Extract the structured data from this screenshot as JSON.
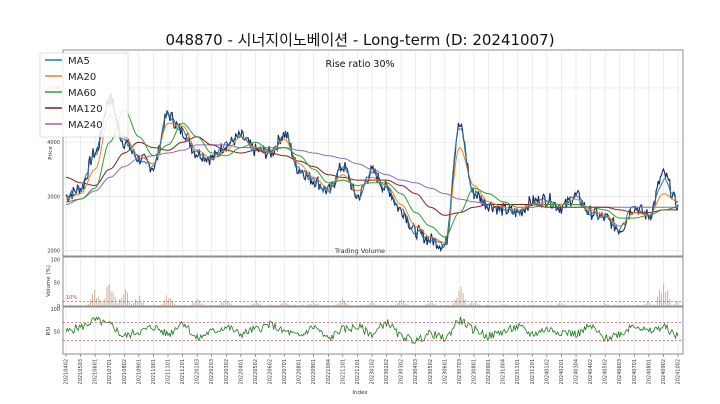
{
  "chart_data": {
    "type": "line",
    "title": "048870 - 시너지이노베이션 - Long-term (D: 20241007)",
    "annotation": "Rise ratio 30%",
    "volume_label": "Trading Volume",
    "xlabel": "Index",
    "ylabel": "Price",
    "volume_ylabel": "Volume (%)",
    "rsi_ylabel": "RSI",
    "volume_threshold_label": "10%",
    "ylim": [
      1900,
      5700
    ],
    "yticks": [
      2000,
      3000,
      4000,
      5000
    ],
    "volume_yticks": [
      0,
      50,
      100
    ],
    "volume_ylim": [
      0,
      105
    ],
    "volume_threshold": 10,
    "rsi_yticks": [
      50,
      100
    ],
    "rsi_ylim": [
      0,
      105
    ],
    "rsi_lines": [
      70,
      30
    ],
    "grid": true,
    "legend_position": "top-left",
    "colors": {
      "price": "#1a2a5a",
      "MA5": "#1f77b4",
      "MA20": "#ff7f0e",
      "MA60": "#2ca02c",
      "MA120": "#8c1c1c",
      "MA240": "#9467bd",
      "volume": "#c8a894",
      "rsi": "#1a7a1a",
      "threshold": "#cc3333"
    },
    "x_dates": [
      "20210402",
      "20210503",
      "20210601",
      "20210701",
      "20210802",
      "20210901",
      "20211001",
      "20211101",
      "20211201",
      "20220103",
      "20220203",
      "20220302",
      "20220401",
      "20220502",
      "20220602",
      "20220701",
      "20220801",
      "20220901",
      "20221004",
      "20221101",
      "20221201",
      "20230102",
      "20230202",
      "20230302",
      "20230403",
      "20230502",
      "20230601",
      "20230703",
      "20230801",
      "20230901",
      "20231004",
      "20231101",
      "20231201",
      "20240102",
      "20240201",
      "20240304",
      "20240402",
      "20240502",
      "20240603",
      "20240701",
      "20240801",
      "20240902",
      "20241002"
    ],
    "price_anchors": [
      3000,
      3150,
      3800,
      4800,
      4000,
      3700,
      3550,
      4500,
      4200,
      3800,
      3700,
      3950,
      4100,
      3850,
      3800,
      4150,
      3500,
      3300,
      3100,
      3550,
      3000,
      3450,
      3150,
      2750,
      2350,
      2200,
      2100,
      4300,
      3050,
      2850,
      2750,
      2700,
      2900,
      2950,
      2800,
      3000,
      2700,
      2600,
      2400,
      2800,
      2650,
      3400,
      2850
    ],
    "ma_anchors": {
      "MA5": [
        3000,
        3150,
        3800,
        4800,
        4000,
        3700,
        3550,
        4500,
        4200,
        3800,
        3700,
        3950,
        4100,
        3850,
        3800,
        4150,
        3500,
        3300,
        3100,
        3550,
        3000,
        3450,
        3150,
        2750,
        2350,
        2200,
        2100,
        4300,
        3050,
        2850,
        2750,
        2700,
        2900,
        2950,
        2800,
        3000,
        2700,
        2600,
        2400,
        2800,
        2650,
        3300,
        2900
      ],
      "MA20": [
        2950,
        3050,
        3500,
        4500,
        4100,
        3750,
        3600,
        4350,
        4300,
        3850,
        3700,
        3850,
        4100,
        3900,
        3800,
        4050,
        3600,
        3350,
        3150,
        3400,
        3100,
        3350,
        3200,
        2850,
        2450,
        2250,
        2150,
        3900,
        3200,
        2900,
        2800,
        2750,
        2850,
        2900,
        2850,
        2950,
        2750,
        2650,
        2450,
        2700,
        2650,
        3050,
        2900
      ],
      "MA60": [
        2900,
        2950,
        3150,
        4000,
        4600,
        4100,
        3750,
        3950,
        4350,
        4100,
        3800,
        3750,
        3900,
        4000,
        3850,
        3900,
        3750,
        3500,
        3250,
        3300,
        3200,
        3250,
        3250,
        3050,
        2700,
        2450,
        2250,
        2700,
        3150,
        3050,
        2900,
        2800,
        2800,
        2850,
        2850,
        2850,
        2800,
        2750,
        2600,
        2600,
        2650,
        2750,
        2800
      ],
      "MA120": [
        3350,
        3250,
        3200,
        3500,
        3800,
        4000,
        3900,
        3850,
        4000,
        4100,
        3950,
        3850,
        3800,
        3850,
        3800,
        3750,
        3650,
        3550,
        3400,
        3350,
        3300,
        3300,
        3300,
        3200,
        3050,
        2800,
        2650,
        2700,
        2800,
        2850,
        2850,
        2850,
        2850,
        2800,
        2800,
        2800,
        2800,
        2800,
        2750,
        2700,
        2700,
        2750,
        2750
      ],
      "MA240": [
        2850,
        2950,
        3100,
        3350,
        3550,
        3700,
        3750,
        3800,
        3850,
        3950,
        3950,
        3950,
        3900,
        3900,
        3900,
        3900,
        3850,
        3800,
        3750,
        3700,
        3600,
        3500,
        3400,
        3300,
        3250,
        3150,
        3050,
        2950,
        2900,
        2850,
        2850,
        2850,
        2850,
        2850,
        2850,
        2850,
        2800,
        2800,
        2800,
        2800,
        2800,
        2800,
        2800
      ]
    },
    "volume_spikes": [
      [
        2,
        40
      ],
      [
        3,
        90
      ],
      [
        4,
        55
      ],
      [
        5,
        25
      ],
      [
        7,
        30
      ],
      [
        9,
        20
      ],
      [
        11,
        25
      ],
      [
        13,
        15
      ],
      [
        15,
        10
      ],
      [
        17,
        12
      ],
      [
        19,
        20
      ],
      [
        21,
        10
      ],
      [
        23,
        15
      ],
      [
        25,
        10
      ],
      [
        27,
        55
      ],
      [
        28,
        12
      ],
      [
        30,
        8
      ],
      [
        34,
        10
      ],
      [
        37,
        8
      ],
      [
        40,
        10
      ],
      [
        41,
        75
      ],
      [
        42,
        12
      ]
    ],
    "rsi_anchors": [
      50,
      60,
      75,
      65,
      40,
      50,
      60,
      45,
      70,
      35,
      50,
      60,
      45,
      55,
      65,
      50,
      40,
      60,
      35,
      55,
      60,
      45,
      70,
      40,
      30,
      45,
      35,
      75,
      55,
      40,
      50,
      60,
      45,
      55,
      50,
      45,
      60,
      35,
      45,
      65,
      50,
      60,
      40
    ],
    "series": [
      {
        "name": "MA5"
      },
      {
        "name": "MA20"
      },
      {
        "name": "MA60"
      },
      {
        "name": "MA120"
      },
      {
        "name": "MA240"
      }
    ]
  }
}
